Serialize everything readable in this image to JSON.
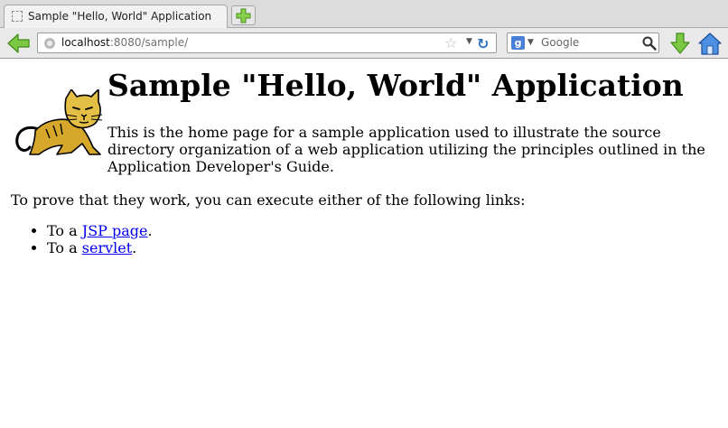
{
  "browser": {
    "tab": {
      "title": "Sample \"Hello, World\" Application"
    },
    "address": {
      "host": "localhost",
      "rest": ":8080/sample/"
    },
    "search": {
      "engine": "g",
      "placeholder": "Google"
    }
  },
  "page": {
    "title": "Sample \"Hello, World\" Application",
    "intro": "This is the home page for a sample application used to illustrate the source directory organization of a web application utilizing the principles outlined in the Application Developer's Guide.",
    "prove_text": "To prove that they work, you can execute either of the following links:",
    "links": [
      {
        "prefix": "To a ",
        "link_text": "JSP page",
        "suffix": "."
      },
      {
        "prefix": "To a ",
        "link_text": "servlet",
        "suffix": "."
      }
    ]
  },
  "icons": {
    "tab": "blank-page-icon",
    "new_tab": "plus-icon",
    "back": "back-arrow-icon",
    "site": "globe-icon",
    "bookmark": "star-icon",
    "reload": "reload-icon",
    "search": "magnifier-icon",
    "downloads": "download-arrow-icon",
    "home": "home-icon",
    "logo": "tomcat-icon"
  },
  "colors": {
    "link": "#0000ee",
    "accent_green": "#6cbf2e",
    "accent_blue": "#3a7bd5"
  }
}
